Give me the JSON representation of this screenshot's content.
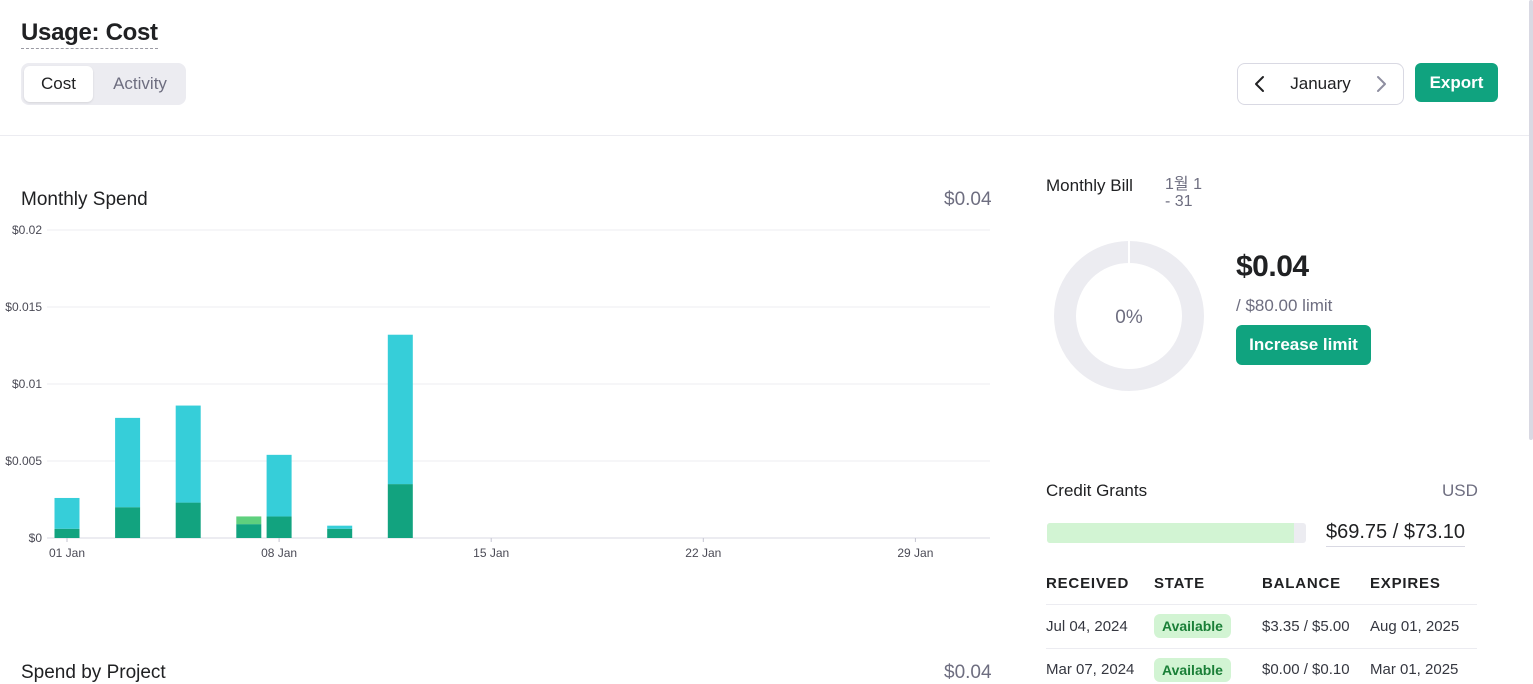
{
  "page": {
    "title": "Usage: Cost"
  },
  "tabs": [
    {
      "label": "Cost",
      "active": true
    },
    {
      "label": "Activity",
      "active": false
    }
  ],
  "month_nav": {
    "label": "January"
  },
  "export_label": "Export",
  "monthly_spend": {
    "title": "Monthly Spend",
    "amount": "$0.04"
  },
  "colors": {
    "accent": "#10a37f",
    "series_dark": "#12a37f",
    "series_light": "#36ced9",
    "series_green": "#5fd07e"
  },
  "chart_data": {
    "type": "bar",
    "stacked": true,
    "x": [
      "01 Jan",
      "02 Jan",
      "03 Jan",
      "04 Jan",
      "05 Jan",
      "06 Jan",
      "07 Jan",
      "08 Jan",
      "09 Jan",
      "10 Jan",
      "11 Jan",
      "12 Jan",
      "13 Jan",
      "14 Jan",
      "15 Jan",
      "16 Jan",
      "17 Jan",
      "18 Jan",
      "19 Jan",
      "20 Jan",
      "21 Jan",
      "22 Jan",
      "23 Jan",
      "24 Jan",
      "25 Jan",
      "26 Jan",
      "27 Jan",
      "28 Jan",
      "29 Jan",
      "30 Jan",
      "31 Jan"
    ],
    "x_tick_labels": [
      "01 Jan",
      "08 Jan",
      "15 Jan",
      "22 Jan",
      "29 Jan"
    ],
    "y_tick_labels": [
      "$0",
      "$0.005",
      "$0.01",
      "$0.015",
      "$0.02"
    ],
    "ylim": [
      0,
      0.02
    ],
    "grid": true,
    "series": [
      {
        "color": "#12a37f",
        "values": [
          0.0006,
          0,
          0.002,
          0,
          0.0023,
          0,
          0.0009,
          0.0014,
          0,
          0.0006,
          0,
          0.0035,
          0,
          0,
          0,
          0,
          0,
          0,
          0,
          0,
          0,
          0,
          0,
          0,
          0,
          0,
          0,
          0,
          0,
          0,
          0
        ]
      },
      {
        "color": "#36ced9",
        "values": [
          0.002,
          0,
          0.0058,
          0,
          0.0063,
          0,
          0,
          0.004,
          0,
          0.0002,
          0,
          0.0097,
          0,
          0,
          0,
          0,
          0,
          0,
          0,
          0,
          0,
          0,
          0,
          0,
          0,
          0,
          0,
          0,
          0,
          0,
          0
        ]
      },
      {
        "color": "#5fd07e",
        "values": [
          0,
          0,
          0,
          0,
          0,
          0,
          0.0005,
          0,
          0,
          0,
          0,
          0,
          0,
          0,
          0,
          0,
          0,
          0,
          0,
          0,
          0,
          0,
          0,
          0,
          0,
          0,
          0,
          0,
          0,
          0,
          0
        ]
      }
    ]
  },
  "monthly_bill": {
    "title": "Monthly Bill",
    "range_line1": "1월 1",
    "range_line2": "- 31",
    "percent_label": "0%",
    "percent_value": 0,
    "amount": "$0.04",
    "limit": "/ $80.00 limit",
    "increase_label": "Increase limit"
  },
  "credit_grants": {
    "title": "Credit Grants",
    "currency": "USD",
    "used_fraction": 0.954,
    "total": "$69.75 / $73.10",
    "columns": [
      "RECEIVED",
      "STATE",
      "BALANCE",
      "EXPIRES"
    ],
    "rows": [
      {
        "received": "Jul 04, 2024",
        "state": "Available",
        "balance": "$3.35 / $5.00",
        "expires": "Aug 01, 2025"
      },
      {
        "received": "Mar 07, 2024",
        "state": "Available",
        "balance": "$0.00 / $0.10",
        "expires": "Mar 01, 2025"
      }
    ]
  },
  "spend_by_project": {
    "title": "Spend by Project",
    "amount": "$0.04"
  }
}
